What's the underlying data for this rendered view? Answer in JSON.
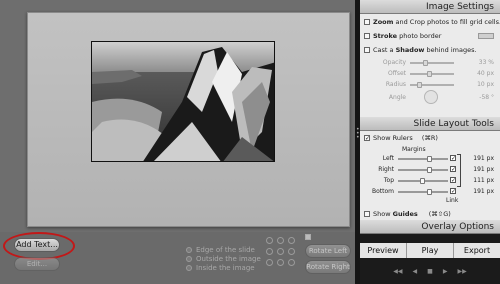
{
  "bottom_toolbar": {
    "add_text_label": "Add Text...",
    "edit_label": "Edit...",
    "radio_options": [
      "Edge of the slide",
      "Outside the image",
      "Inside the image"
    ],
    "rotate_left_label": "Rotate Left",
    "rotate_right_label": "Rotate Right"
  },
  "image_settings": {
    "title": "Image Settings",
    "zoom_crop_bold": "Zoom",
    "zoom_crop_rest": "and Crop photos to fill grid cells.",
    "stroke_bold": "Stroke",
    "stroke_rest": "photo border",
    "shadow_prefix": "Cast a",
    "shadow_bold": "Shadow",
    "shadow_rest": "behind images.",
    "sliders": [
      {
        "label": "Opacity",
        "value": "33 %"
      },
      {
        "label": "Offset",
        "value": "40 px"
      },
      {
        "label": "Radius",
        "value": "10 px"
      },
      {
        "label": "Angle",
        "value": "-58 °"
      }
    ]
  },
  "slide_layout": {
    "title": "Slide Layout Tools",
    "show_rulers_label": "Show Rulers",
    "show_rulers_shortcut": "(⌘R)",
    "margins_label": "Margins",
    "margins": [
      {
        "label": "Left",
        "value": "191 px",
        "level": 0.6
      },
      {
        "label": "Right",
        "value": "191 px",
        "level": 0.6
      },
      {
        "label": "Top",
        "value": "111 px",
        "level": 0.45
      },
      {
        "label": "Bottom",
        "value": "191 px",
        "level": 0.6
      }
    ],
    "link_label": "Link",
    "show_guides_bold": "Guides",
    "show_guides_prefix": "Show",
    "show_guides_shortcut": "(⌘⇧G)"
  },
  "overlay_options": {
    "title": "Overlay Options"
  },
  "playback": {
    "preview_label": "Preview",
    "play_label": "Play",
    "export_label": "Export",
    "transport": [
      "◀◀",
      "◀",
      "■",
      "▶",
      "▶▶"
    ]
  }
}
